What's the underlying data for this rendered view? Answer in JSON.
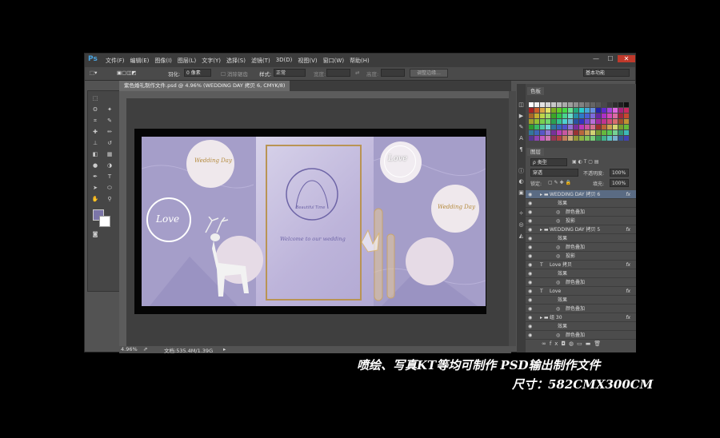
{
  "app": {
    "logo": "Ps",
    "menu": [
      "文件(F)",
      "编辑(E)",
      "图像(I)",
      "图层(L)",
      "文字(Y)",
      "选择(S)",
      "滤镜(T)",
      "3D(D)",
      "视图(V)",
      "窗口(W)",
      "帮助(H)"
    ],
    "window_controls": [
      "—",
      "☐",
      "✕"
    ]
  },
  "options": {
    "feather_label": "羽化:",
    "feather_value": "0 像素",
    "antialias_label": "消除锯齿",
    "style_label": "样式:",
    "style_value": "正常",
    "width_label": "宽度:",
    "height_label": "高度:",
    "refine_edge_button": "调整边缘...",
    "workspace_value": "基本功能"
  },
  "document": {
    "tab_title": "紫色婚礼制作文件.psd @ 4.96% (WEDDING DAY 拷贝 6, CMYK/8)",
    "zoom": "4.96%",
    "doc_size": "文档:535.4M/1.39G"
  },
  "artwork": {
    "wedding_day_text": "Wedding Day",
    "love_text": "Love",
    "monogram_text": "Beautiful Time",
    "welcome_text": "Welcome to our wedding"
  },
  "panels": {
    "color_tab": "色板",
    "layers_tab": "图层",
    "kind_filter": "ρ 类型",
    "blend_mode": "穿透",
    "opacity_label": "不透明度:",
    "opacity_value": "100%",
    "lock_label": "锁定:",
    "fill_label": "填充:",
    "fill_value": "100%"
  },
  "layers": [
    {
      "name": "WEDDING DAY 拷贝 6",
      "type": "folder",
      "fx": "fx",
      "indent": 0,
      "selected": true
    },
    {
      "name": "效果",
      "type": "effects",
      "fx": "",
      "indent": 1,
      "selected": false
    },
    {
      "name": "颜色叠加",
      "type": "effect",
      "fx": "",
      "indent": 2,
      "selected": false
    },
    {
      "name": "投影",
      "type": "effect",
      "fx": "",
      "indent": 2,
      "selected": false
    },
    {
      "name": "WEDDING DAY 拷贝 5",
      "type": "folder",
      "fx": "fx",
      "indent": 0,
      "selected": false
    },
    {
      "name": "效果",
      "type": "effects",
      "fx": "",
      "indent": 1,
      "selected": false
    },
    {
      "name": "颜色叠加",
      "type": "effect",
      "fx": "",
      "indent": 2,
      "selected": false
    },
    {
      "name": "投影",
      "type": "effect",
      "fx": "",
      "indent": 2,
      "selected": false
    },
    {
      "name": "Love 拷贝",
      "type": "text",
      "fx": "fx",
      "indent": 0,
      "selected": false
    },
    {
      "name": "效果",
      "type": "effects",
      "fx": "",
      "indent": 1,
      "selected": false
    },
    {
      "name": "颜色叠加",
      "type": "effect",
      "fx": "",
      "indent": 2,
      "selected": false
    },
    {
      "name": "Love",
      "type": "text",
      "fx": "fx",
      "indent": 0,
      "selected": false
    },
    {
      "name": "效果",
      "type": "effects",
      "fx": "",
      "indent": 1,
      "selected": false
    },
    {
      "name": "颜色叠加",
      "type": "effect",
      "fx": "",
      "indent": 2,
      "selected": false
    },
    {
      "name": "组 30",
      "type": "folder",
      "fx": "fx",
      "indent": 0,
      "selected": false
    },
    {
      "name": "效果",
      "type": "effects",
      "fx": "",
      "indent": 1,
      "selected": false
    },
    {
      "name": "颜色叠加",
      "type": "effect",
      "fx": "",
      "indent": 2,
      "selected": false
    }
  ],
  "captions": {
    "line1": "喷绘、写真KT等均可制作  PSD输出制作文件",
    "line2": "尺寸：582CMX300CM"
  },
  "colors": {
    "accent_selection": "#5a6b83",
    "artwork_purple": "#a59ec9",
    "gold": "#b99454"
  }
}
